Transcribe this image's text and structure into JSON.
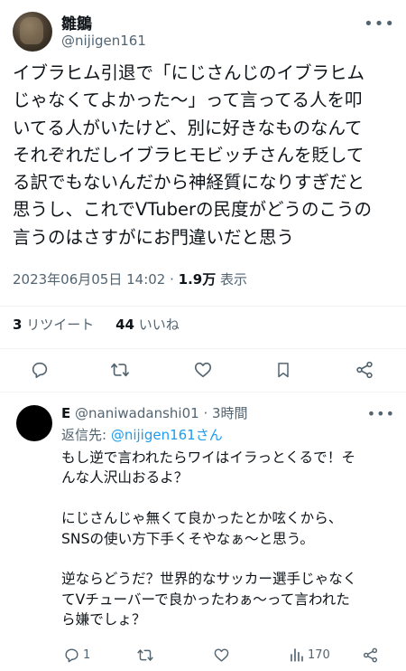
{
  "tweet": {
    "author": {
      "display_name": "雛鶵",
      "handle": "@nijigen161"
    },
    "more_icon": "ellipsis-icon",
    "text": "イブラヒム引退で「にじさんじのイブラヒム\nじゃなくてよかった〜」って言ってる人を叩\nいてる人がいたけど、別に好きなものなんて\nそれぞれだしイブラヒモビッチさんを貶して\nる訳でもないんだから神経質になりすぎだと\n思うし、これでVTuberの民度がどうのこうの\n言うのはさすがにお門違いだと思う",
    "timestamp": "2023年06月05日 14:02",
    "separator": " · ",
    "views_count": "1.9万",
    "views_label": " 表示",
    "retweets_count": "3",
    "retweets_label": " リツイート",
    "likes_count": "44",
    "likes_label": " いいね",
    "action_icons": [
      "reply-icon",
      "retweet-icon",
      "like-icon",
      "bookmark-icon",
      "share-icon"
    ]
  },
  "reply": {
    "author_name": "E",
    "handle": "@naniwadanshi01",
    "separator": " · ",
    "time": "3時間",
    "reply_to_label": "返信先: ",
    "reply_to_handle": "@nijigen161さん",
    "text": "もし逆で言われたらワイはイラっとくるで！そ\nんな人沢山おるよ？\n\nにじさんじゃ無くて良かったとか呟くから、\nSNSの使い方下手くそやなぁ〜と思う。\n\n逆ならどうだ？世界的なサッカー選手じゃなく\nてVチューバーで良かったわぁ〜って言われた\nら嫌でしょ？",
    "reply_count": "1",
    "views_count": "170",
    "action_icons": [
      "reply-icon",
      "retweet-icon",
      "like-icon",
      "views-icon",
      "share-icon"
    ]
  }
}
